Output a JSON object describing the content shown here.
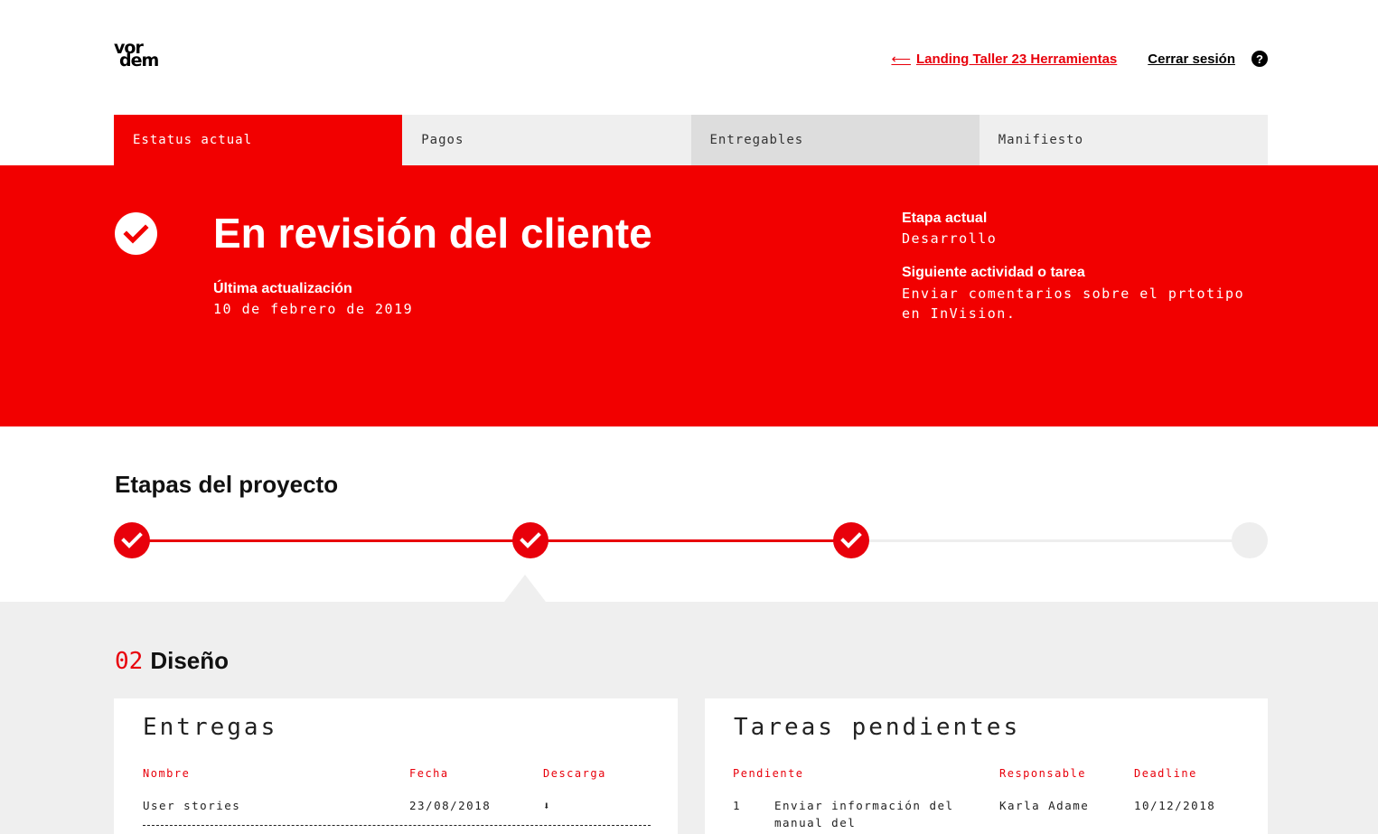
{
  "header": {
    "logo_line1": "vor",
    "logo_line2": "dem",
    "back_arrow": "⟵",
    "back_link": "Landing Taller 23 Herramientas",
    "logout": "Cerrar sesión",
    "help": "?"
  },
  "tabs": [
    {
      "label": "Estatus actual",
      "active": true
    },
    {
      "label": "Pagos",
      "active": false
    },
    {
      "label": "Entregables",
      "active": false
    },
    {
      "label": "Manifiesto",
      "active": false
    }
  ],
  "status": {
    "title": "En revisión del cliente",
    "last_update_label": "Última actualización",
    "last_update_value": "10 de febrero de 2019",
    "current_stage_label": "Etapa actual",
    "current_stage_value": "Desarrollo",
    "next_activity_label": "Siguiente actividad o tarea",
    "next_activity_value": "Enviar comentarios sobre el prtotipo en InVision."
  },
  "stages": {
    "title": "Etapas del proyecto",
    "nodes": [
      {
        "status": "done",
        "icon": "check-icon"
      },
      {
        "status": "done",
        "icon": "check-icon"
      },
      {
        "status": "done",
        "icon": "check-icon"
      },
      {
        "status": "pending",
        "icon": ""
      }
    ]
  },
  "selected_stage": {
    "number": "02",
    "name": "Diseño"
  },
  "deliveries": {
    "title": "Entregas",
    "headers": [
      "Nombre",
      "Fecha",
      "Descarga"
    ],
    "rows": [
      {
        "name": "User stories",
        "date": "23/08/2018",
        "download_icon": "⬇"
      }
    ]
  },
  "tasks": {
    "title": "Tareas pendientes",
    "headers": [
      "Pendiente",
      "Responsable",
      "Deadline"
    ],
    "rows": [
      {
        "num": "1",
        "task": "Enviar información del manual del participante.",
        "owner": "Karla Adame",
        "deadline": "10/12/2018"
      }
    ]
  },
  "colors": {
    "brand_red": "#f20000",
    "accent_red": "#e8000b",
    "tab_bg": "#efefef",
    "section_bg": "#efefef"
  }
}
